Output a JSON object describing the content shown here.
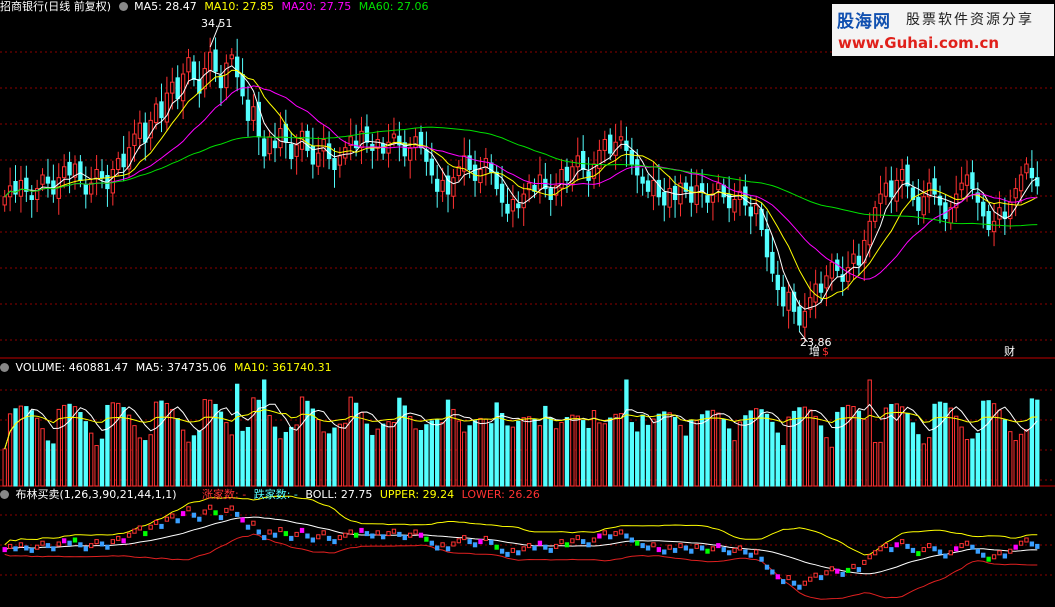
{
  "main": {
    "title": "招商银行(日线 前复权)",
    "ma5": "MA5: 28.47",
    "ma10": "MA10: 27.85",
    "ma20": "MA20: 27.75",
    "ma60": "MA60: 27.06",
    "high_label": "34.51",
    "low_label": "23.86",
    "markers": [
      "增",
      "$",
      "财"
    ]
  },
  "volume": {
    "title": "VOLUME: 460881.47",
    "ma5": "MA5: 374735.06",
    "ma10": "MA10: 361740.31"
  },
  "boll": {
    "title": "布林买卖(1,26,3,90,21,44,1,1)",
    "up_count": "涨家数: -",
    "down_count": "跌家数: -",
    "boll": "BOLL: 27.75",
    "upper": "UPPER: 29.24",
    "lower": "LOWER: 26.26"
  },
  "logo": {
    "name": "股海网",
    "tagline": "股票软件资源分享",
    "url": "www.Guhai.com.cn"
  },
  "colors": {
    "up": "#ff3232",
    "down": "#54ffff",
    "ma5": "#ffffff",
    "ma10": "#ffff00",
    "ma20": "#ff00ff",
    "ma60": "#00e000",
    "grid": "#8b0000"
  },
  "chart_data": [
    {
      "type": "candlestick",
      "title": "招商银行(日线 前复权)",
      "ylim": [
        23.0,
        35.5
      ],
      "highest": 34.51,
      "lowest": 23.86,
      "close_approx": [
        28.8,
        29.2,
        28.9,
        29.4,
        29.0,
        28.7,
        29.1,
        29.6,
        29.3,
        28.9,
        29.5,
        29.9,
        29.6,
        30.0,
        29.4,
        28.9,
        29.3,
        29.8,
        29.5,
        29.1,
        29.8,
        30.2,
        29.9,
        30.6,
        31.1,
        31.5,
        30.8,
        31.6,
        32.2,
        31.7,
        32.6,
        33.0,
        32.4,
        33.3,
        33.9,
        33.1,
        32.6,
        33.5,
        34.1,
        33.4,
        32.8,
        33.7,
        34.0,
        33.2,
        32.5,
        31.6,
        32.1,
        31.0,
        30.3,
        31.0,
        30.6,
        31.3,
        30.8,
        30.2,
        30.7,
        31.2,
        30.5,
        30.0,
        30.4,
        30.9,
        30.2,
        29.8,
        30.3,
        30.6,
        31.0,
        30.6,
        31.2,
        30.8,
        30.5,
        30.9,
        30.4,
        30.8,
        31.1,
        30.7,
        30.3,
        30.6,
        31.0,
        30.6,
        30.1,
        29.6,
        29.0,
        29.4,
        28.9,
        29.5,
        29.9,
        30.3,
        29.8,
        29.4,
        29.8,
        30.2,
        29.7,
        29.1,
        28.6,
        28.2,
        28.7,
        28.4,
        28.9,
        29.3,
        29.0,
        29.6,
        29.1,
        28.7,
        29.2,
        29.8,
        29.4,
        29.9,
        30.3,
        29.8,
        29.4,
        30.0,
        30.5,
        30.9,
        30.4,
        30.8,
        31.0,
        30.5,
        30.0,
        29.6,
        29.3,
        29.0,
        29.4,
        28.8,
        28.5,
        29.1,
        28.7,
        29.3,
        29.0,
        28.6,
        29.2,
        29.0,
        28.6,
        28.9,
        29.3,
        28.8,
        28.4,
        28.7,
        29.0,
        28.5,
        28.1,
        28.5,
        27.6,
        26.6,
        26.0,
        25.4,
        24.8,
        25.3,
        24.6,
        24.1,
        24.6,
        25.1,
        25.6,
        25.3,
        25.9,
        26.4,
        26.1,
        25.7,
        26.2,
        26.7,
        26.3,
        27.2,
        27.9,
        28.4,
        28.9,
        29.3,
        28.8,
        29.4,
        29.8,
        29.2,
        28.7,
        28.3,
        28.8,
        29.3,
        28.9,
        28.5,
        28.0,
        28.4,
        28.9,
        29.3,
        29.6,
        29.1,
        28.6,
        28.1,
        27.6,
        27.9,
        28.4,
        28.0,
        28.6,
        29.1,
        29.6,
        30.0,
        29.5,
        29.2
      ]
    },
    {
      "type": "bar",
      "title": "VOLUME",
      "value": 460881.47,
      "ma5": 374735.06,
      "ma10": 361740.31
    },
    {
      "type": "line",
      "title": "布林买卖(1,26,3,90,21,44,1,1)",
      "boll": 27.75,
      "upper": 29.24,
      "lower": 26.26
    }
  ]
}
